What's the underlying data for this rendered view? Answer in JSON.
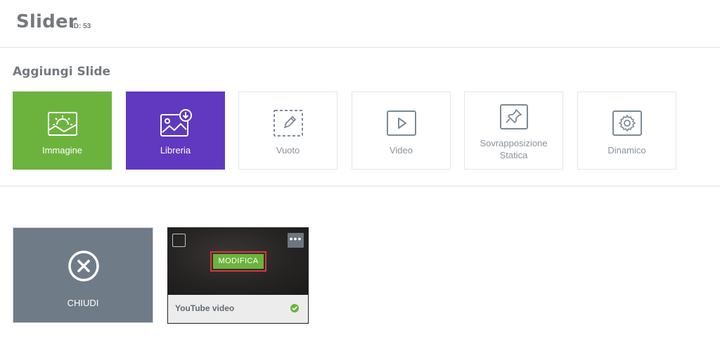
{
  "header": {
    "title": "Slider",
    "id_label": "ID: 53"
  },
  "add_section": {
    "title": "Aggiungi Slide",
    "tiles": [
      {
        "label": "Immagine",
        "icon": "image-sun-icon",
        "color": "#6cb33e"
      },
      {
        "label": "Libreria",
        "icon": "library-download-icon",
        "color": "#6039c0"
      },
      {
        "label": "Vuoto",
        "icon": "dashed-pencil-icon"
      },
      {
        "label": "Video",
        "icon": "play-icon"
      },
      {
        "label": "Sovrapposizione Statica",
        "icon": "pin-icon"
      },
      {
        "label": "Dinamico",
        "icon": "gear-icon"
      }
    ]
  },
  "close_card": {
    "label": "CHIUDI",
    "icon": "close-circle-icon",
    "color": "#6f7b86"
  },
  "slide": {
    "name": "YouTube video",
    "edit_label": "MODIFICA",
    "menu_label": "•••",
    "status_icon": "check-circle-icon",
    "status_color": "#6cb33e"
  }
}
